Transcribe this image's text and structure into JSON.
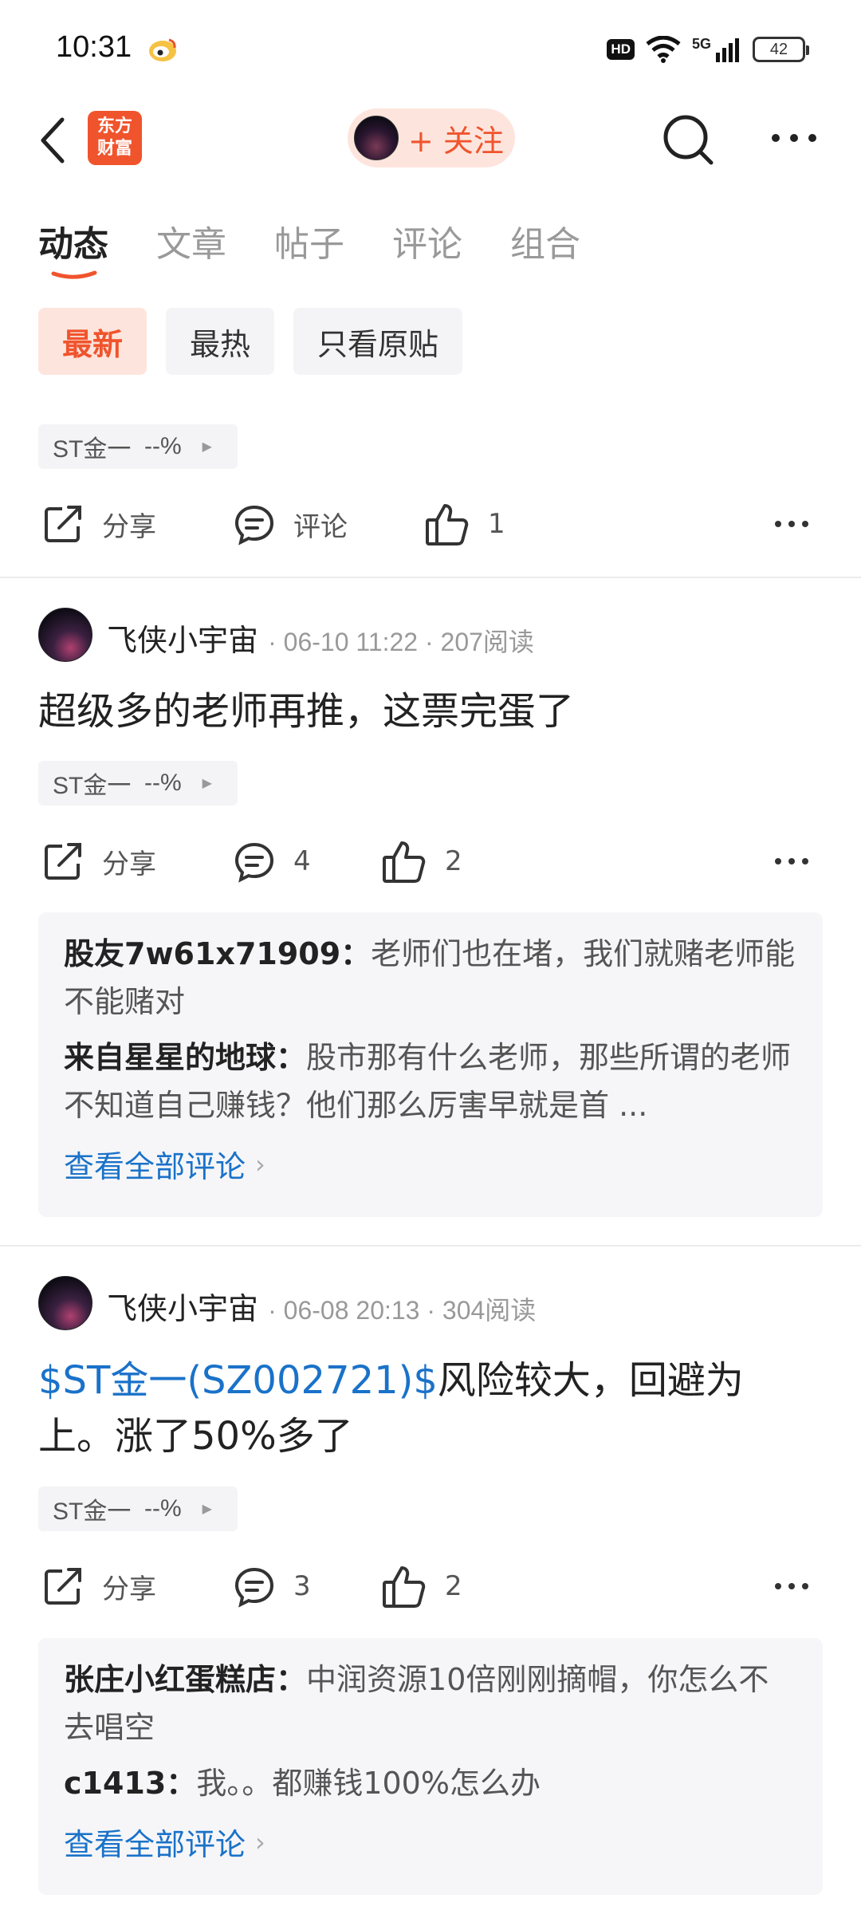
{
  "status_bar": {
    "time": "10:31",
    "hd": "HD",
    "network": "5G",
    "battery": "42",
    "icons": [
      "weibo-icon",
      "wifi-icon",
      "signal-icon"
    ]
  },
  "header": {
    "logo_line1": "东方",
    "logo_line2": "财富",
    "follow_label": "+ 关注",
    "icons": [
      "back-icon",
      "search-icon",
      "more-icon"
    ]
  },
  "tabs": [
    {
      "label": "动态",
      "active": true
    },
    {
      "label": "文章",
      "active": false
    },
    {
      "label": "帖子",
      "active": false
    },
    {
      "label": "评论",
      "active": false
    },
    {
      "label": "组合",
      "active": false
    }
  ],
  "filters": [
    {
      "label": "最新",
      "active": true
    },
    {
      "label": "最热",
      "active": false
    },
    {
      "label": "只看原贴",
      "active": false
    }
  ],
  "first_post": {
    "stock_tag": "ST金一",
    "stock_change": "--%",
    "share_label": "分享",
    "comment_label": "评论",
    "like_count": "1"
  },
  "posts": [
    {
      "author": "飞侠小宇宙",
      "meta": "· 06-10 11:22 · 207阅读",
      "text": "超级多的老师再推，这票完蛋了",
      "stock_tag": "ST金一",
      "stock_change": "--%",
      "share_label": "分享",
      "comment_count": "4",
      "like_count": "2",
      "comments": [
        {
          "user": "股友7w61x71909",
          "text": "老师们也在堵，我们就赌老师能不能赌对"
        },
        {
          "user": "来自星星的地球",
          "text": "股市那有什么老师，那些所谓的老师不知道自己赚钱？他们那么厉害早就是首 ..."
        }
      ],
      "view_all": "查看全部评论"
    },
    {
      "author": "飞侠小宇宙",
      "meta": "· 06-08 20:13 · 304阅读",
      "text_link": "$ST金一(SZ002721)$",
      "text": "风险较大，回避为上。涨了50%多了",
      "stock_tag": "ST金一",
      "stock_change": "--%",
      "share_label": "分享",
      "comment_count": "3",
      "like_count": "2",
      "comments": [
        {
          "user": "张庄小红蛋糕店",
          "text": "中润资源10倍刚刚摘帽，你怎么不去唱空"
        },
        {
          "user": "c1413",
          "text": "我。。都赚钱100%怎么办"
        }
      ],
      "view_all": "查看全部评论"
    }
  ],
  "colors": {
    "accent": "#f0542d",
    "link": "#1a72c9",
    "chip_active_bg": "#fde5dd"
  }
}
